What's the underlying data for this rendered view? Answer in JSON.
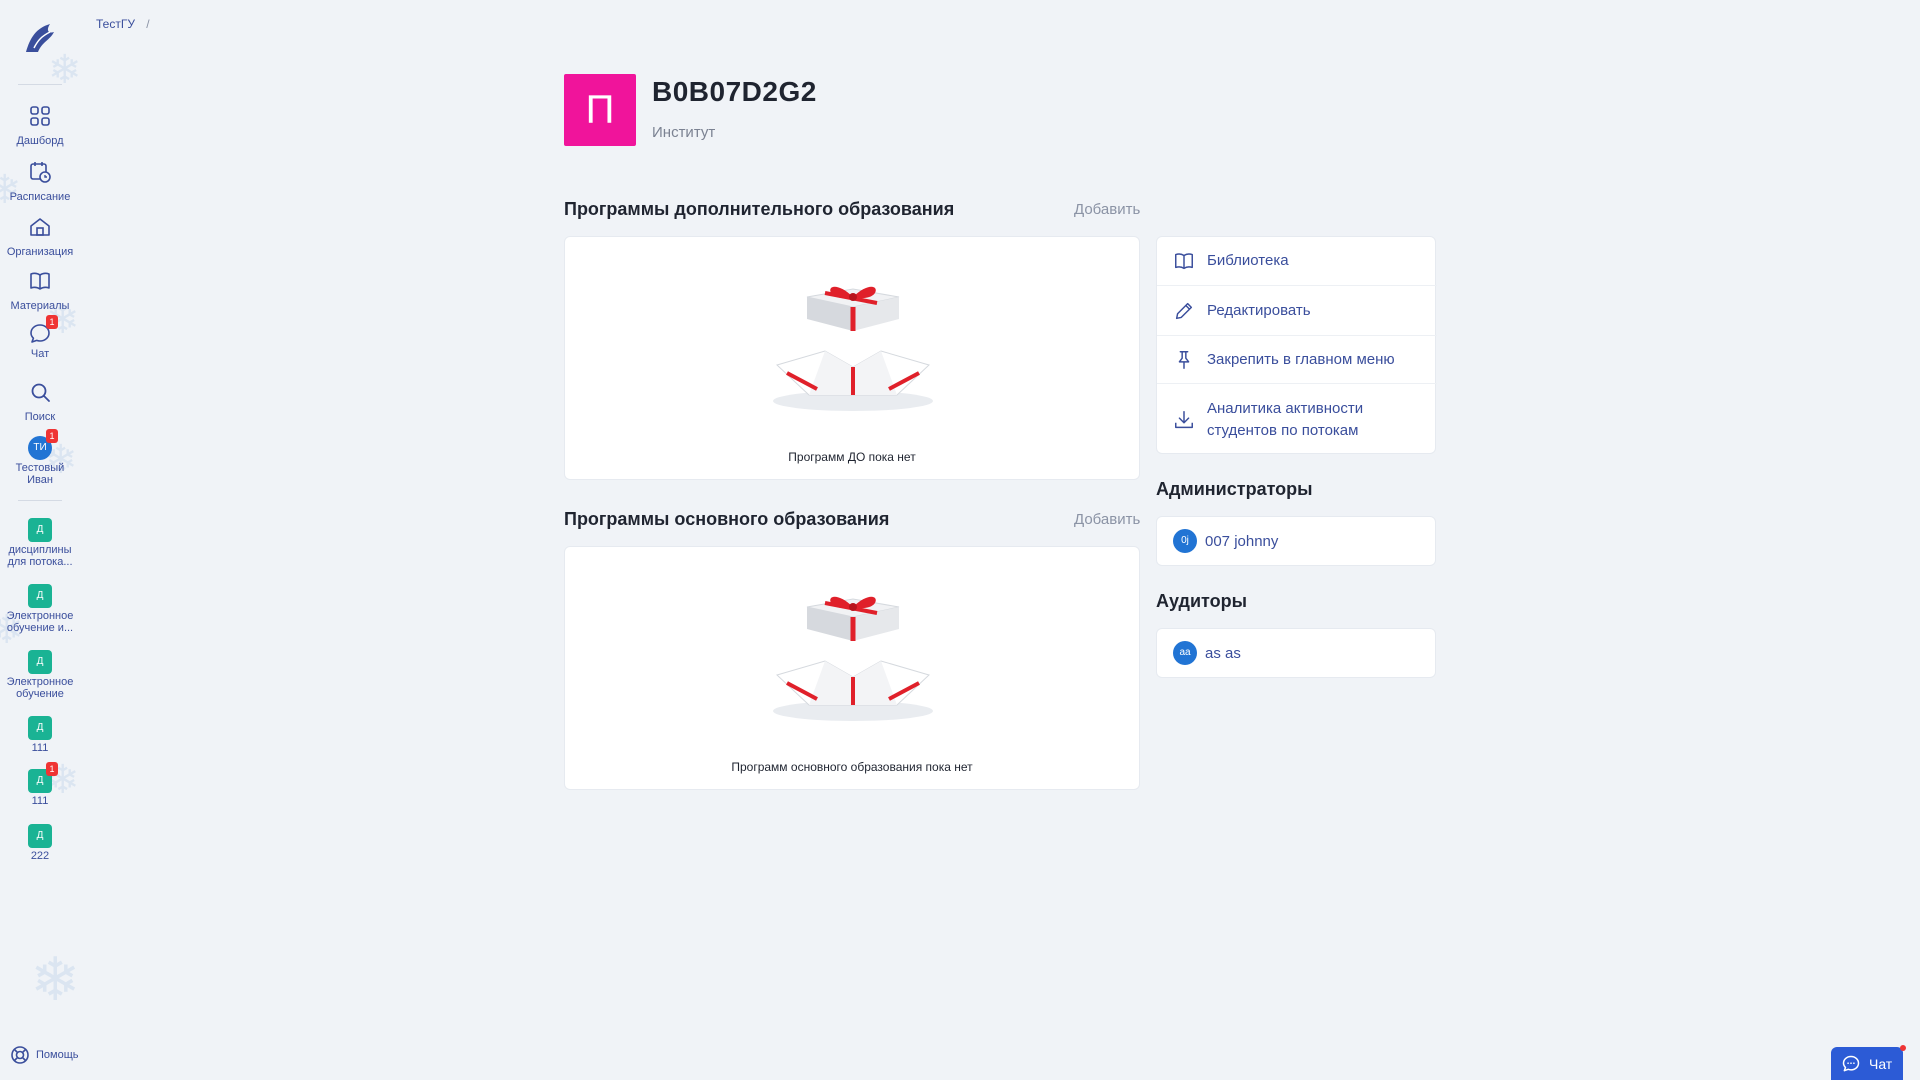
{
  "breadcrumb": {
    "root": "ТестГУ",
    "separator": "/"
  },
  "sidebar": {
    "items": [
      {
        "label": "Дашборд"
      },
      {
        "label": "Расписание"
      },
      {
        "label": "Организация"
      },
      {
        "label": "Материалы"
      },
      {
        "label": "Чат",
        "badge": "1"
      },
      {
        "label": "Поиск"
      },
      {
        "label": "Тестовый Иван",
        "initials": "ТИ",
        "badge": "1"
      }
    ],
    "courses": [
      {
        "letter": "Д",
        "label": "дисциплины для потока..."
      },
      {
        "letter": "Д",
        "label": "Электронное обучение и..."
      },
      {
        "letter": "Д",
        "label": "Электронное обучение"
      },
      {
        "letter": "Д",
        "label": "111"
      },
      {
        "letter": "Д",
        "label": "111",
        "badge": "1"
      },
      {
        "letter": "Д",
        "label": "222"
      }
    ],
    "help_label": "Помощь"
  },
  "org": {
    "letter": "П",
    "title": "B0B07D2G2",
    "subtitle": "Институт",
    "color": "#f0149b"
  },
  "sections": {
    "additional": {
      "title": "Программы дополнительного образования",
      "add_label": "Добавить",
      "empty_text": "Программ ДО пока нет"
    },
    "main": {
      "title": "Программы основного образования",
      "add_label": "Добавить",
      "empty_text": "Программ основного образования пока нет"
    }
  },
  "actions": [
    {
      "label": "Библиотека",
      "icon": "book-icon"
    },
    {
      "label": "Редактировать",
      "icon": "pencil-icon"
    },
    {
      "label": "Закрепить в главном меню",
      "icon": "pin-icon"
    },
    {
      "label": "Аналитика активности студентов по потокам",
      "icon": "download-icon"
    }
  ],
  "administrators": {
    "title": "Администраторы",
    "people": [
      {
        "initials": "0j",
        "name": "007 johnny"
      }
    ]
  },
  "auditors": {
    "title": "Аудиторы",
    "people": [
      {
        "initials": "aa",
        "name": "as as"
      }
    ]
  },
  "chat_widget": {
    "label": "Чат"
  }
}
